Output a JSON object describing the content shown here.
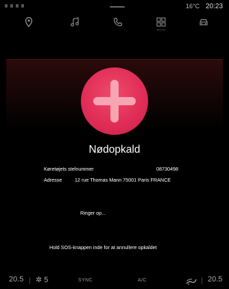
{
  "status_bar": {
    "temperature": "16°C",
    "time": "20:23"
  },
  "nav": {
    "items": [
      {
        "icon": "location-pin-icon"
      },
      {
        "icon": "music-note-icon"
      },
      {
        "icon": "phone-icon"
      },
      {
        "icon": "apps-grid-icon"
      },
      {
        "icon": "car-icon"
      }
    ]
  },
  "call": {
    "title": "Nødopkald",
    "vin_label": "Køretøjets stelnummer",
    "vin_value": "08730498",
    "address_label": "Adresse",
    "address_value": "12 rue Thomas Mann 75001 Paris FRANCE",
    "status": "Ringer op...",
    "hint": "Hold SOS-knappen inde for at annullere opkaldet"
  },
  "climate": {
    "left_temp": "20.5",
    "fan_level": "5",
    "sync_label": "SYNC",
    "ac_label": "A/C",
    "right_temp": "20.5"
  },
  "colors": {
    "sos_button": "#e12e58",
    "sos_plus": "#f7a4b3",
    "background": "#000000"
  }
}
